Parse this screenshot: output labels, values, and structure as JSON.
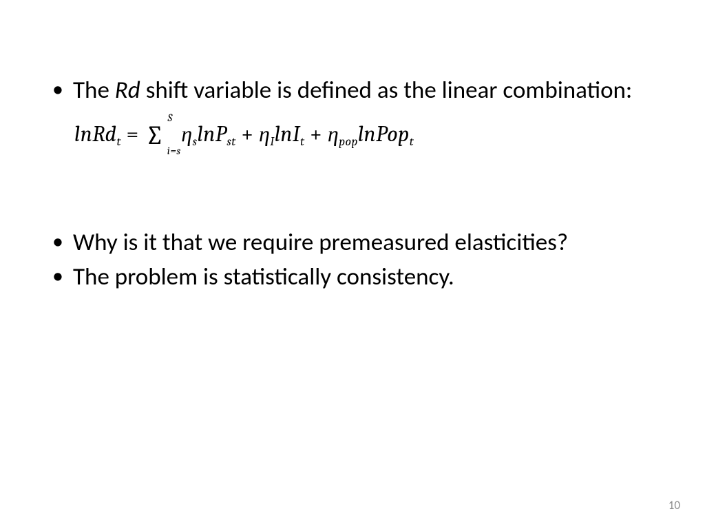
{
  "bullets": {
    "b1_pre": "The ",
    "b1_var": "Rd",
    "b1_post": " shift variable is defined as the linear combination:",
    "b2": "Why is it that we require premeasured elasticities?",
    "b3": "The problem is statistically consistency."
  },
  "equation": {
    "lhs_ln": "ln",
    "lhs_var": "Rd",
    "lhs_sub": "t",
    "eq": " = ",
    "sum_lower": "i=s",
    "sum_upper": "S",
    "eta_s": "η",
    "eta_s_sub": "s",
    "t1_ln": "ln",
    "t1_var": "P",
    "t1_sub": "st",
    "plus1": " + ",
    "eta_I": "η",
    "eta_I_sub": "I",
    "t2_ln": "ln",
    "t2_var": "I",
    "t2_sub": "t",
    "plus2": " + ",
    "eta_pop": "η",
    "eta_pop_sub": "pop",
    "t3_ln": "ln",
    "t3_var": "Pop",
    "t3_sub": "t"
  },
  "page_number": "10"
}
